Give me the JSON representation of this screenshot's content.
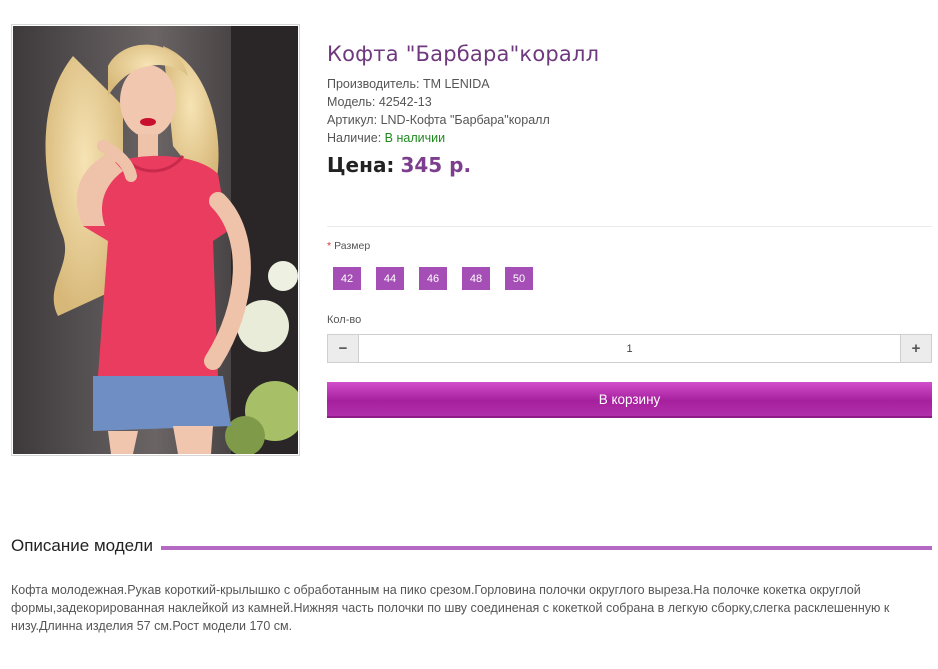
{
  "product": {
    "title": "Кофта \"Барбара\"коралл",
    "manufacturer_label": "Производитель:",
    "manufacturer": "TM LENIDA",
    "model_label": "Модель:",
    "model": "42542-13",
    "sku_label": "Артикул:",
    "sku": "LND-Кофта \"Барбара\"коралл",
    "availability_label": "Наличие:",
    "availability": "В наличии",
    "price_label": "Цена:",
    "price": "345 р."
  },
  "options": {
    "size_required_mark": "*",
    "size_label": "Размер",
    "sizes": [
      "42",
      "44",
      "46",
      "48",
      "50"
    ],
    "qty_label": "Кол-во",
    "qty_value": "1",
    "qty_minus": "−",
    "qty_plus": "+"
  },
  "cart_button_label": "В корзину",
  "description": {
    "heading": "Описание модели",
    "text": "Кофта молодежная.Рукав короткий-крылышко с обработанным на пико срезом.Горловина полочки округлого выреза.На полочке кокетка округлой формы,задекорированная наклейкой из камней.Нижняя часть полочки по шву соединеная с кокеткой собрана в легкую сборку,слегка расклешенную к низу.Длинна изделия 57 см.Рост модели 170 см."
  },
  "colors": {
    "title": "#6f3a7d",
    "price": "#7c3f8e",
    "size_button": "#a54fb6",
    "cart_button": "#a5209c",
    "in_stock": "#1e8a1e",
    "description_rule": "#b46ac2"
  }
}
